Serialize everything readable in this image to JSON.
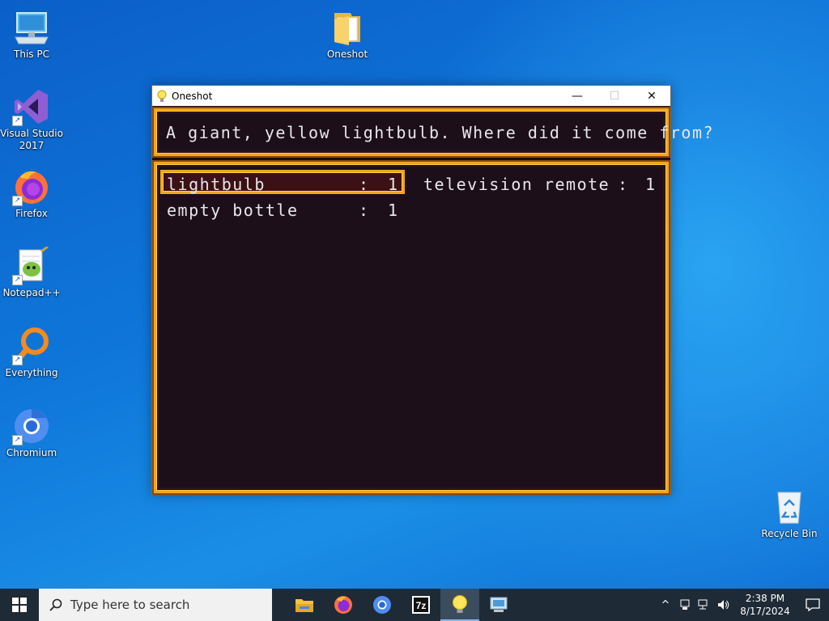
{
  "desktop": {
    "icons": [
      {
        "label": "This PC",
        "icon": "computer-icon"
      },
      {
        "label": "Visual Studio\n2017",
        "icon": "visual-studio-icon"
      },
      {
        "label": "Firefox",
        "icon": "firefox-icon"
      },
      {
        "label": "Notepad++",
        "icon": "notepadpp-icon"
      },
      {
        "label": "Everything",
        "icon": "everything-search-icon"
      },
      {
        "label": "Chromium",
        "icon": "chromium-icon"
      },
      {
        "label": "Oneshot",
        "icon": "folder-icon"
      },
      {
        "label": "Recycle Bin",
        "icon": "recycle-bin-icon"
      }
    ]
  },
  "window": {
    "title": "Oneshot",
    "icon": "lightbulb-icon",
    "controls": {
      "minimize": "—",
      "maximize": "☐",
      "close": "✕"
    }
  },
  "game": {
    "description": "A giant, yellow lightbulb. Where did it come from?",
    "items": [
      {
        "name": "lightbulb",
        "colon": ":",
        "qty": "1",
        "selected": true
      },
      {
        "name": "television remote",
        "colon": ":",
        "qty": "1",
        "selected": false
      },
      {
        "name": "empty bottle",
        "colon": ":",
        "qty": "1",
        "selected": false
      }
    ],
    "colors": {
      "frame": "#f3a51c",
      "background": "#1c0f19",
      "text": "#e9e6ea",
      "selection": "#3b1019"
    }
  },
  "taskbar": {
    "search_placeholder": "Type here to search",
    "apps": [
      "file-explorer-icon",
      "firefox-icon",
      "chromium-icon",
      "7zip-icon",
      "oneshot-lightbulb-icon",
      "control-panel-icon"
    ],
    "active_app": "oneshot-lightbulb-icon",
    "clock": {
      "time": "2:38 PM",
      "date": "8/17/2024"
    }
  }
}
